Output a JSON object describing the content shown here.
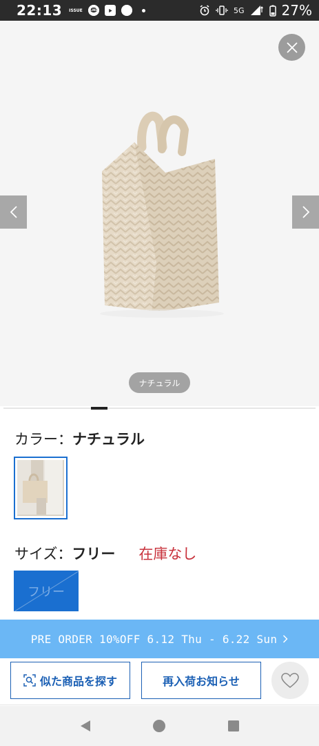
{
  "status_bar": {
    "time": "22:13",
    "notification_icons": [
      "fashion-app-icon",
      "line-icon",
      "youtube-icon",
      "zozotown-icon"
    ],
    "fashion_app_text": "ISSUE",
    "zozotown_text": "ZOZO TOWN",
    "network": "5G",
    "battery": "27%"
  },
  "gallery": {
    "color_label": "ナチュラル",
    "product_colors": {
      "bag": "#e3d6c2",
      "background": "#f5f5f5"
    }
  },
  "product": {
    "color_label": "カラー：",
    "color_value": "ナチュラル",
    "size_label": "サイズ：",
    "size_value": "フリー",
    "stock_status": "在庫なし",
    "size_option": "フリー"
  },
  "banner": {
    "text": "PRE ORDER 10%OFF 6.12 Thu - 6.22 Sun"
  },
  "actions": {
    "similar_label": "似た商品を探す",
    "restock_label": "再入荷お知らせ"
  },
  "colors": {
    "accent": "#1a6fd0",
    "banner": "#6bb7f5",
    "stock_red": "#c8323c"
  }
}
